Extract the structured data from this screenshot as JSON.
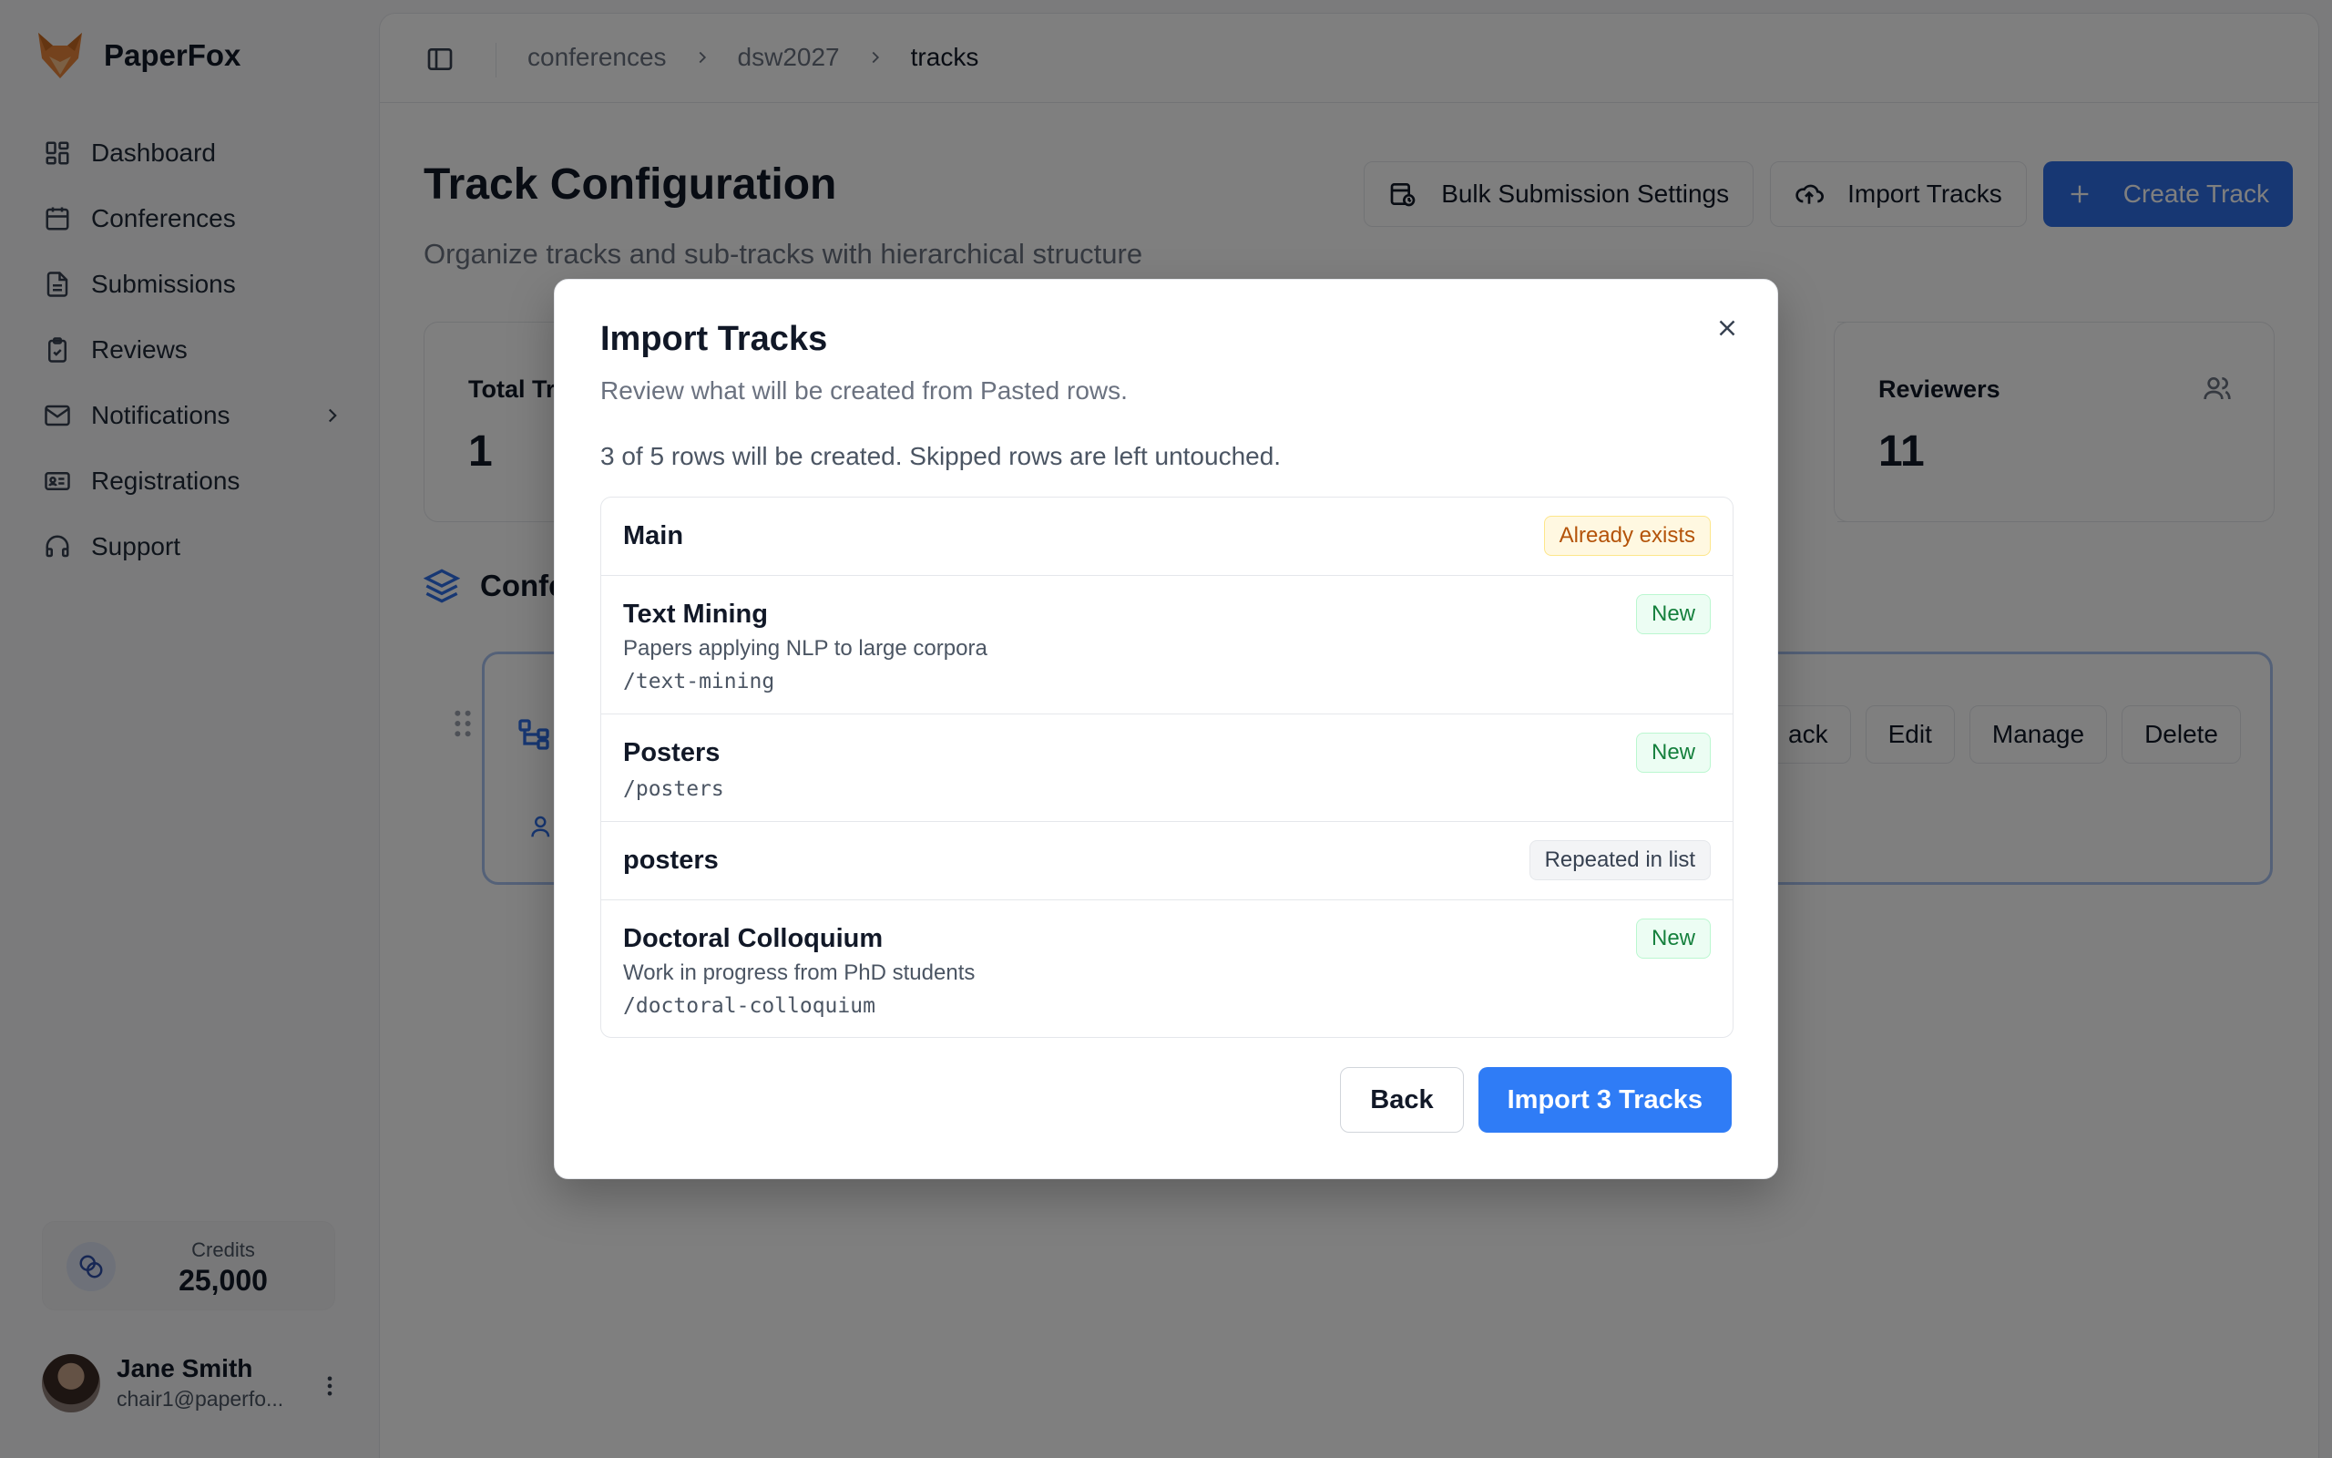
{
  "app": {
    "name": "PaperFox"
  },
  "sidebar": {
    "items": [
      {
        "label": "Dashboard",
        "icon": "dashboard-icon"
      },
      {
        "label": "Conferences",
        "icon": "calendar-icon"
      },
      {
        "label": "Submissions",
        "icon": "document-icon"
      },
      {
        "label": "Reviews",
        "icon": "clipboard-icon"
      },
      {
        "label": "Notifications",
        "icon": "mail-icon"
      },
      {
        "label": "Registrations",
        "icon": "id-card-icon"
      },
      {
        "label": "Support",
        "icon": "headset-icon"
      }
    ],
    "credits": {
      "label": "Credits",
      "value": "25,000"
    },
    "user": {
      "name": "Jane Smith",
      "email": "chair1@paperfo..."
    }
  },
  "breadcrumb": [
    "conferences",
    "dsw2027",
    "tracks"
  ],
  "page": {
    "title": "Track Configuration",
    "subtitle": "Organize tracks and sub-tracks with hierarchical structure",
    "actions": {
      "bulk": "Bulk Submission Settings",
      "import": "Import Tracks",
      "create": "Create Track"
    }
  },
  "stats": [
    {
      "label": "Total Tr",
      "value": "1"
    },
    {
      "label": "Reviewers",
      "value": "11"
    }
  ],
  "section": {
    "title": "Confe"
  },
  "track_card": {
    "buttons": [
      "ack",
      "Edit",
      "Manage",
      "Delete"
    ]
  },
  "modal": {
    "title": "Import Tracks",
    "subtitle": "Review what will be created from Pasted rows.",
    "summary": "3 of 5 rows will be created. Skipped rows are left untouched.",
    "rows": [
      {
        "name": "Main",
        "description": "",
        "slug": "",
        "status": "Already exists"
      },
      {
        "name": "Text Mining",
        "description": "Papers applying NLP to large corpora",
        "slug": "/text-mining",
        "status": "New"
      },
      {
        "name": "Posters",
        "description": "",
        "slug": "/posters",
        "status": "New"
      },
      {
        "name": "posters",
        "description": "",
        "slug": "",
        "status": "Repeated in list"
      },
      {
        "name": "Doctoral Colloquium",
        "description": "Work in progress from PhD students",
        "slug": "/doctoral-colloquium",
        "status": "New"
      }
    ],
    "back_label": "Back",
    "import_label": "Import 3 Tracks"
  },
  "colors": {
    "primary": "#2f7cf6",
    "badge_new": "#15803d",
    "badge_exists": "#b45309"
  }
}
